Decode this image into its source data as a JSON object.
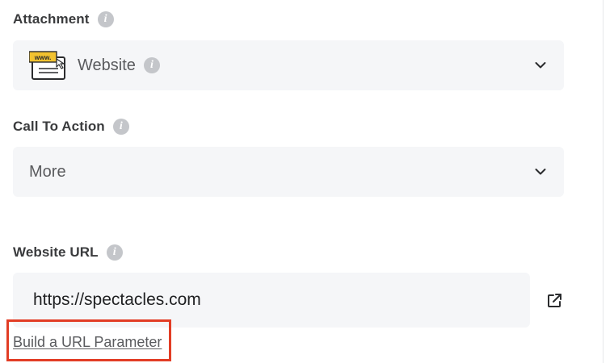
{
  "attachment": {
    "label": "Attachment",
    "value": "Website",
    "icon": "website-attachment-icon"
  },
  "call_to_action": {
    "label": "Call To Action",
    "value": "More"
  },
  "website_url": {
    "label": "Website URL",
    "value": "https://spectacles.com"
  },
  "build_url_parameter": {
    "label": "Build a URL Parameter"
  },
  "colors": {
    "field_background": "#f5f6f8",
    "label_text": "#3a3b3d",
    "info_icon": "#c4c6ca",
    "highlight": "#e23d25"
  }
}
